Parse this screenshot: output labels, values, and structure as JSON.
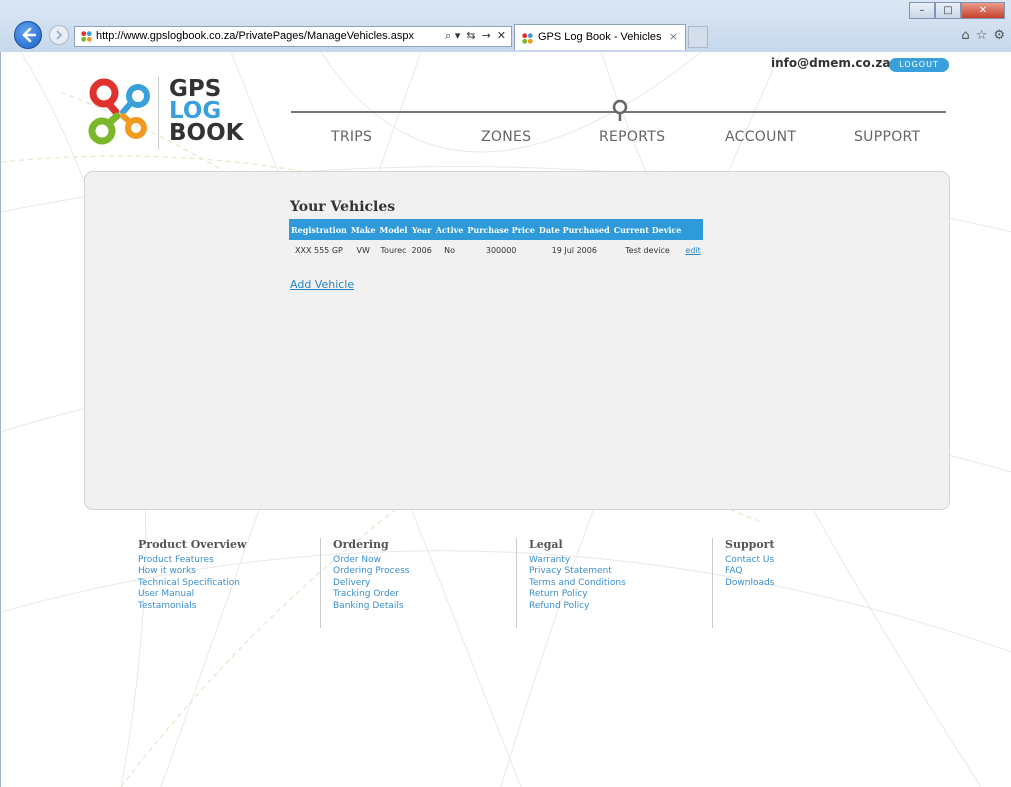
{
  "browser": {
    "url": "http://www.gpslogbook.co.za/PrivatePages/ManageVehicles.aspx",
    "tab_title": "GPS Log Book - Vehicles",
    "tab_close": "×",
    "addr_tools": [
      "⌕ ▾",
      "⇆",
      "→",
      "✕"
    ]
  },
  "header": {
    "user_email": "info@dmem.co.za",
    "logout_label": "LOGOUT",
    "logo_lines": [
      "GPS",
      "LOG",
      "BOOK"
    ]
  },
  "nav": {
    "items": [
      "TRIPS",
      "ZONES",
      "REPORTS",
      "ACCOUNT",
      "SUPPORT"
    ]
  },
  "vehicles": {
    "title": "Your Vehicles",
    "columns": [
      "Registration",
      "Make",
      "Model",
      "Year",
      "Active",
      "Purchase Price",
      "Date Purchased",
      "Current Device"
    ],
    "rows": [
      {
        "registration": "XXX 555 GP",
        "make": "VW",
        "model": "Tourec",
        "year": "2006",
        "active": "No",
        "purchase_price": "300000",
        "date_purchased": "19 Jul 2006",
        "current_device": "Test device",
        "edit_label": "edit"
      }
    ],
    "add_label": "Add Vehicle"
  },
  "footer": {
    "columns": [
      {
        "heading": "Product Overview",
        "links": [
          "Product Features",
          "How it works",
          "Technical Specification",
          "User Manual",
          "Testamonials"
        ]
      },
      {
        "heading": "Ordering",
        "links": [
          "Order Now",
          "Ordering Process",
          "Delivery",
          "Tracking Order",
          "Banking Details"
        ]
      },
      {
        "heading": "Legal",
        "links": [
          "Warranty",
          "Privacy Statement",
          "Terms and Conditions",
          "Return Policy",
          "Refund Policy"
        ]
      },
      {
        "heading": "Support",
        "links": [
          "Contact Us",
          "FAQ",
          "Downloads"
        ]
      }
    ]
  },
  "colors": {
    "accent_blue": "#2e9ad9",
    "link_blue": "#2a84c6",
    "logo_red": "#e0322c",
    "logo_blue": "#3aa0dc",
    "logo_green": "#7ab72a",
    "logo_orange": "#f29a1f"
  }
}
